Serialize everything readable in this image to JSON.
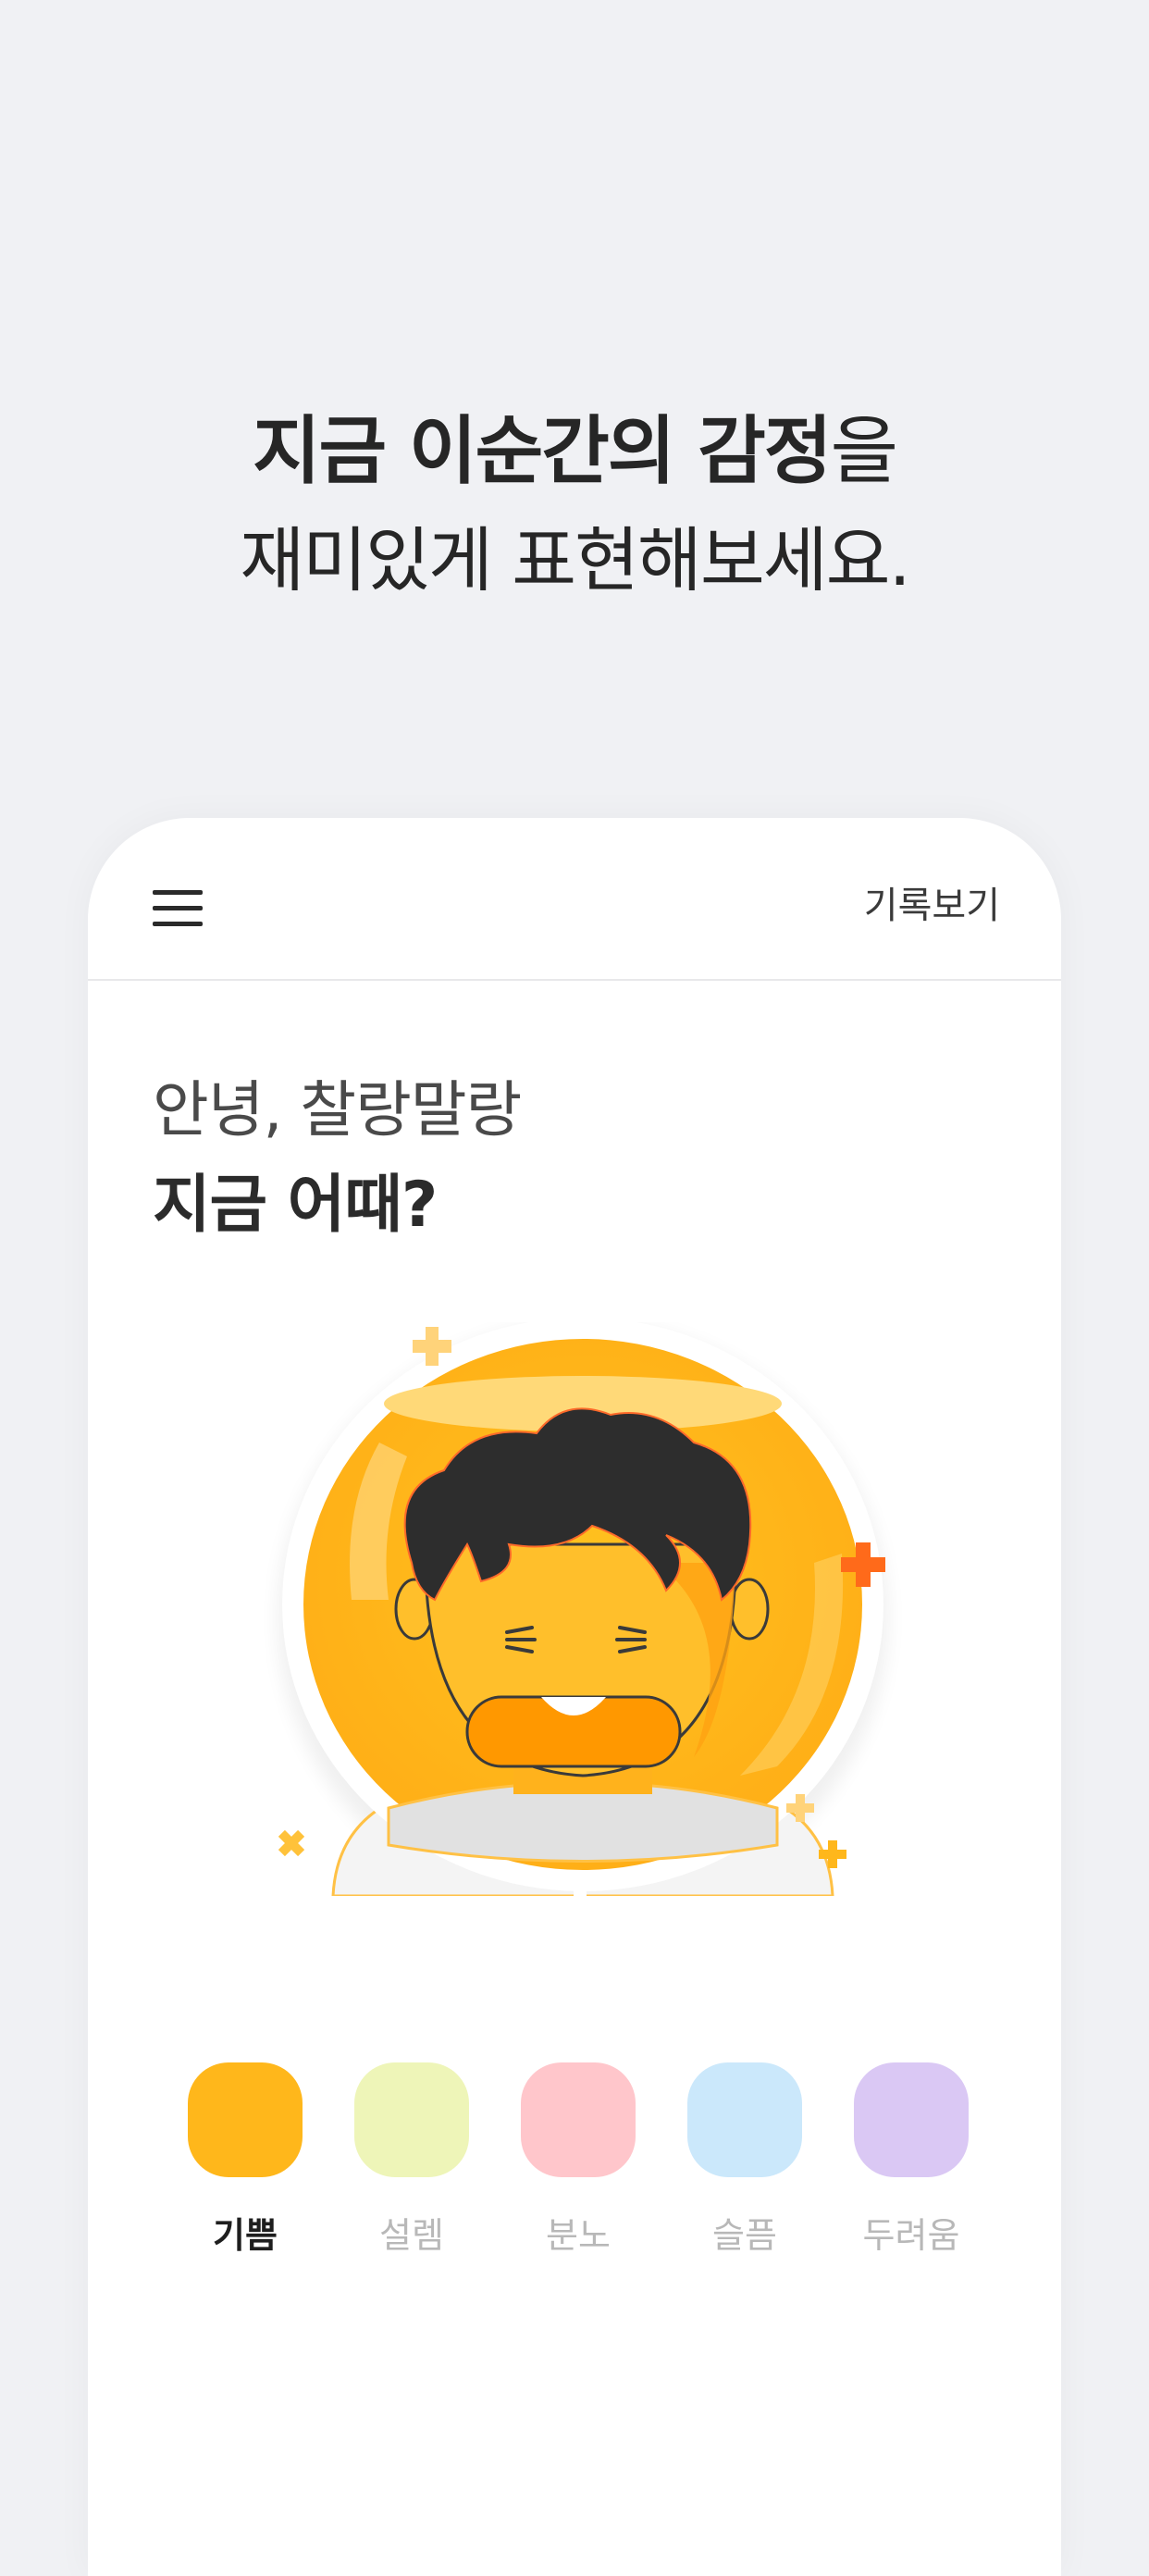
{
  "headline": {
    "line1_bold": "지금 이순간의 감정",
    "line1_rest": "을",
    "line2": "재미있게 표현해보세요."
  },
  "app": {
    "menu_icon": "hamburger-menu-icon",
    "history_label": "기록보기",
    "greeting": "안녕, 찰랑말랑",
    "question": "지금 어때?",
    "illustration_icon": "happy-character-illustration"
  },
  "moods": [
    {
      "label": "기쁨",
      "color": "#ffb71b",
      "selected": true
    },
    {
      "label": "설렘",
      "color": "#eef5b8",
      "selected": false
    },
    {
      "label": "분노",
      "color": "#ffc6cb",
      "selected": false
    },
    {
      "label": "슬픔",
      "color": "#cbe8fb",
      "selected": false
    },
    {
      "label": "두려움",
      "color": "#dac8f4",
      "selected": false
    }
  ],
  "colors": {
    "background": "#f0f1f4",
    "card": "#ffffff",
    "accent": "#ffb71b"
  }
}
